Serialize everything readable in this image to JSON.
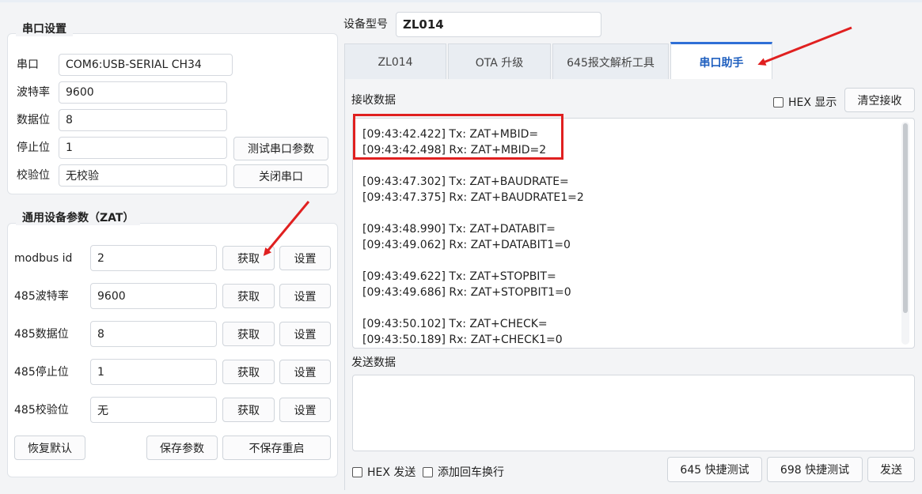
{
  "device": {
    "model_label": "设备型号",
    "model_value": "ZL014"
  },
  "serial_settings": {
    "title": "串口设置",
    "port_label": "串口",
    "port_value": "COM6:USB-SERIAL CH34",
    "baud_label": "波特率",
    "baud_value": "9600",
    "databits_label": "数据位",
    "databits_value": "8",
    "stopbits_label": "停止位",
    "stopbits_value": "1",
    "parity_label": "校验位",
    "parity_value": "无校验",
    "test_button": "测试串口参数",
    "close_button": "关闭串口"
  },
  "zat_params": {
    "title": "通用设备参数（ZAT）",
    "rows": [
      {
        "label": "modbus id",
        "value": "2",
        "get": "获取",
        "set": "设置"
      },
      {
        "label": "485波特率",
        "value": "9600",
        "get": "获取",
        "set": "设置"
      },
      {
        "label": "485数据位",
        "value": "8",
        "get": "获取",
        "set": "设置"
      },
      {
        "label": "485停止位",
        "value": "1",
        "get": "获取",
        "set": "设置"
      },
      {
        "label": "485校验位",
        "value": "无",
        "get": "获取",
        "set": "设置"
      }
    ],
    "restore_button": "恢复默认",
    "save_button": "保存参数",
    "nosave_reboot_button": "不保存重启"
  },
  "tabs": [
    {
      "label": "ZL014"
    },
    {
      "label": "OTA 升级"
    },
    {
      "label": "645报文解析工具"
    },
    {
      "label": "串口助手"
    }
  ],
  "serial_assistant": {
    "recv_label": "接收数据",
    "hex_display_label": "HEX 显示",
    "clear_button": "清空接收",
    "recv_lines": [
      "[09:43:42.422] Tx: ZAT+MBID=",
      "[09:43:42.498] Rx: ZAT+MBID=2",
      "",
      "[09:43:47.302] Tx: ZAT+BAUDRATE=",
      "[09:43:47.375] Rx: ZAT+BAUDRATE1=2",
      "",
      "[09:43:48.990] Tx: ZAT+DATABIT=",
      "[09:43:49.062] Rx: ZAT+DATABIT1=0",
      "",
      "[09:43:49.622] Tx: ZAT+STOPBIT=",
      "[09:43:49.686] Rx: ZAT+STOPBIT1=0",
      "",
      "[09:43:50.102] Tx: ZAT+CHECK=",
      "[09:43:50.189] Rx: ZAT+CHECK1=0"
    ],
    "send_label": "发送数据",
    "send_value": "",
    "hex_send_label": "HEX 发送",
    "append_crlf_label": "添加回车换行",
    "quick_645_button": "645 快捷测试",
    "quick_698_button": "698 快捷测试",
    "send_button": "发送"
  },
  "colors": {
    "accent": "#2f6fd6",
    "annotation_red": "#e02020"
  }
}
